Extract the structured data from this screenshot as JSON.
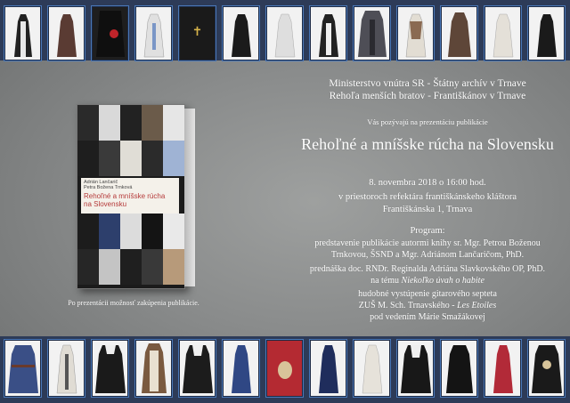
{
  "invitation": {
    "org_line1": "Ministerstvo vnútra SR - Štátny archív v Trnave",
    "org_line2": "Rehoľa menších bratov - Františkánov v Trnave",
    "invite_line": "Vás pozývajú na prezentáciu publikácie",
    "title": "Rehoľné a mníšske rúcha na Slovensku",
    "date_line": "8. novembra 2018 o 16:00 hod.",
    "place_line1": "v priestoroch refektára františkánskeho kláštora",
    "place_line2": "Františkánska 1, Trnava",
    "program_label": "Program:",
    "program_item1_line1": "predstavenie publikácie autormi knihy sr. Mgr. Petrou Boženou",
    "program_item1_line2": "Trnkovou, ŠSND a Mgr. Adriánom Lančaričom, PhD.",
    "program_item2_line1": "prednáška doc. RNDr. Reginalda Adriána Slavkovského OP, PhD.",
    "program_item2_line2_pre": "na tému ",
    "program_item2_line2_it": "Niekoľko úvah o habite",
    "program_item3_line1": "hudobné vystúpenie gitarového septeta",
    "program_item3_line2_pre": "ZUŠ M. Sch. Trnavského - ",
    "program_item3_line2_it": "Les Etoiles",
    "program_item3_line3": "pod vedením Márie Smažákovej",
    "sale_note": "Po prezentácii možnosť zakúpenia publikácie."
  },
  "book": {
    "authors_line1": "Adrián Lančarič",
    "authors_line2": "Petra Božena Trnková",
    "title_line1": "Rehoľné a mníšske rúcha",
    "title_line2": "na Slovensku"
  },
  "colors": {
    "frame": "#2d3b58",
    "tile_border": "#4a78b8",
    "text": "#ffffff",
    "band": "#8a8c8c"
  }
}
